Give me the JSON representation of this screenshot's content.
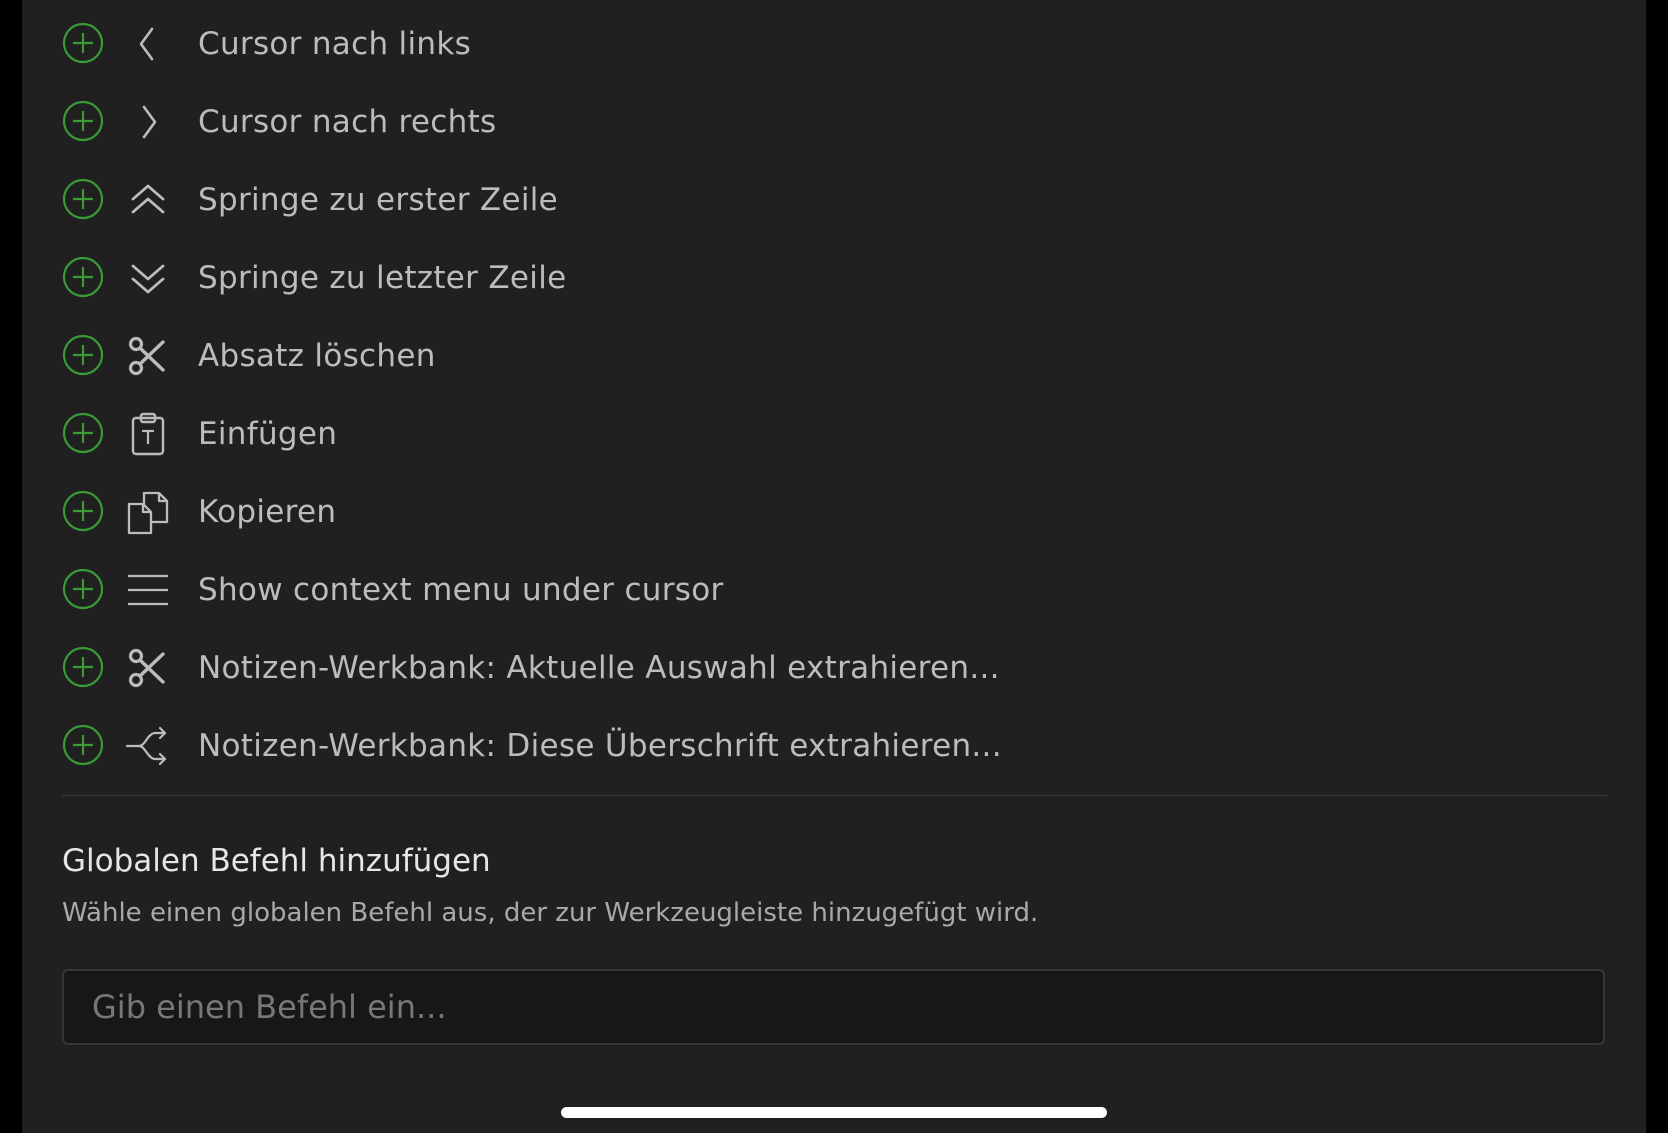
{
  "accent_color": "#3a9a35",
  "commands": [
    {
      "label": "Cursor nach links",
      "icon": "chevron-left-icon"
    },
    {
      "label": "Cursor nach rechts",
      "icon": "chevron-right-icon"
    },
    {
      "label": "Springe zu erster Zeile",
      "icon": "chevrons-up-icon"
    },
    {
      "label": "Springe zu letzter Zeile",
      "icon": "chevrons-down-icon"
    },
    {
      "label": "Absatz löschen",
      "icon": "scissors-icon"
    },
    {
      "label": "Einfügen",
      "icon": "clipboard-type-icon"
    },
    {
      "label": "Kopieren",
      "icon": "copy-icon"
    },
    {
      "label": "Show context menu under cursor",
      "icon": "menu-icon"
    },
    {
      "label": "Notizen-Werkbank: Aktuelle Auswahl extrahieren...",
      "icon": "scissors-icon"
    },
    {
      "label": "Notizen-Werkbank: Diese Überschrift extrahieren...",
      "icon": "split-arrow-icon"
    }
  ],
  "global_command": {
    "title": "Globalen Befehl hinzufügen",
    "description": "Wähle einen globalen Befehl aus, der zur Werkzeugleiste hinzugefügt wird.",
    "input_placeholder": "Gib einen Befehl ein...",
    "input_value": ""
  }
}
